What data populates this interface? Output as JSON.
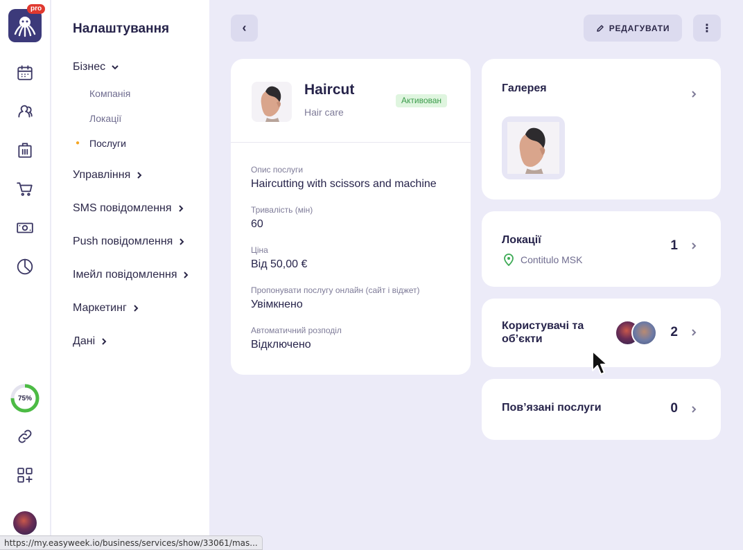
{
  "brand": {
    "badge": "pro"
  },
  "rail": {
    "icons": [
      "calendar-icon",
      "clients-icon",
      "business-icon",
      "cart-icon",
      "cash-icon",
      "reports-icon",
      "link-icon",
      "apps-add-icon"
    ],
    "progress": {
      "label": "75%",
      "value": 0.75,
      "color": "#4cbb44"
    }
  },
  "settings": {
    "title": "Налаштування",
    "business": {
      "label": "Бізнес",
      "children": [
        "Компанія",
        "Локації",
        "Послуги"
      ]
    },
    "items": [
      "Управління",
      "SMS повідомлення",
      "Push повідомлення",
      "Імейл повідомлення",
      "Маркетинг",
      "Дані"
    ]
  },
  "toolbar": {
    "back": "‹",
    "edit": "РЕДАГУВАТИ",
    "more": "⋮"
  },
  "service": {
    "name": "Haircut",
    "category": "Hair care",
    "status": "Активован",
    "fields": [
      {
        "label": "Опис послуги",
        "value": "Haircutting with scissors and machine"
      },
      {
        "label": "Тривалість (мін)",
        "value": "60"
      },
      {
        "label": "Ціна",
        "value": "Від 50,00 €"
      },
      {
        "label": "Пропонувати послугу онлайн (сайт і віджет)",
        "value": "Увімкнено"
      },
      {
        "label": "Автоматичний розподіл",
        "value": "Відключено"
      }
    ]
  },
  "gallery": {
    "title": "Галерея"
  },
  "locations": {
    "title": "Локації",
    "count": "1",
    "item": "Contitulo MSK"
  },
  "users": {
    "title": "Користувачі та об’єкти",
    "count": "2"
  },
  "related": {
    "title": "Пов’язані послуги",
    "count": "0"
  },
  "statusbar": {
    "url": "https://my.easyweek.io/business/services/show/33061/mas..."
  },
  "colors": {
    "accent": "#3c3a7a",
    "active_badge_bg": "#dff5df",
    "active_badge_text": "#3a9b4a",
    "location_pin": "#3daa55"
  }
}
